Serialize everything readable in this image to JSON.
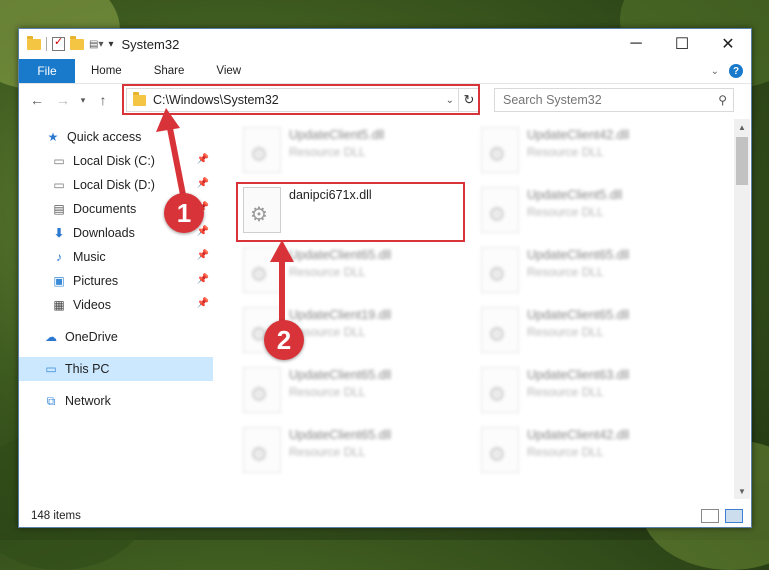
{
  "window": {
    "title": "System32",
    "controls": {
      "minimize": "─",
      "maximize": "☐",
      "close": "✕"
    }
  },
  "ribbon": {
    "file_tab": "File",
    "tabs": [
      "Home",
      "Share",
      "View"
    ]
  },
  "navigation": {
    "address": "C:\\Windows\\System32",
    "search_placeholder": "Search System32"
  },
  "sidebar": {
    "quick_access": "Quick access",
    "items": [
      {
        "label": "Local Disk (C:)",
        "icon": "drive-icon",
        "pinned": true
      },
      {
        "label": "Local Disk (D:)",
        "icon": "drive-icon",
        "pinned": true
      },
      {
        "label": "Documents",
        "icon": "document-icon",
        "pinned": true
      },
      {
        "label": "Downloads",
        "icon": "download-icon",
        "pinned": true
      },
      {
        "label": "Music",
        "icon": "music-icon",
        "pinned": true
      },
      {
        "label": "Pictures",
        "icon": "picture-icon",
        "pinned": true
      },
      {
        "label": "Videos",
        "icon": "video-icon",
        "pinned": true
      }
    ],
    "onedrive": "OneDrive",
    "this_pc": "This PC",
    "network": "Network"
  },
  "files": {
    "highlighted": {
      "name": "danipci671x.dll"
    },
    "left_column": [
      {
        "name": "UpdateClient5.dll",
        "type": "Resource DLL"
      },
      {
        "name": "UpdateClient65.dll",
        "type": "Resource DLL"
      },
      {
        "name": "UpdateClient19.dll",
        "type": "Resource DLL"
      },
      {
        "name": "UpdateClient65.dll",
        "type": "Resource DLL"
      },
      {
        "name": "UpdateClient65.dll",
        "type": "Resource DLL"
      }
    ],
    "right_column": [
      {
        "name": "UpdateClient42.dll",
        "type": "Resource DLL"
      },
      {
        "name": "UpdateClient5.dll",
        "type": "Resource DLL"
      },
      {
        "name": "UpdateClient65.dll",
        "type": "Resource DLL"
      },
      {
        "name": "UpdateClient65.dll",
        "type": "Resource DLL"
      },
      {
        "name": "UpdateClient63.dll",
        "type": "Resource DLL"
      },
      {
        "name": "UpdateClient42.dll",
        "type": "Resource DLL"
      }
    ]
  },
  "status": {
    "count": "148 items"
  },
  "callouts": [
    "1",
    "2"
  ],
  "colors": {
    "accent": "#1979ca",
    "highlight": "#d9333a",
    "selected": "#cce8ff"
  }
}
